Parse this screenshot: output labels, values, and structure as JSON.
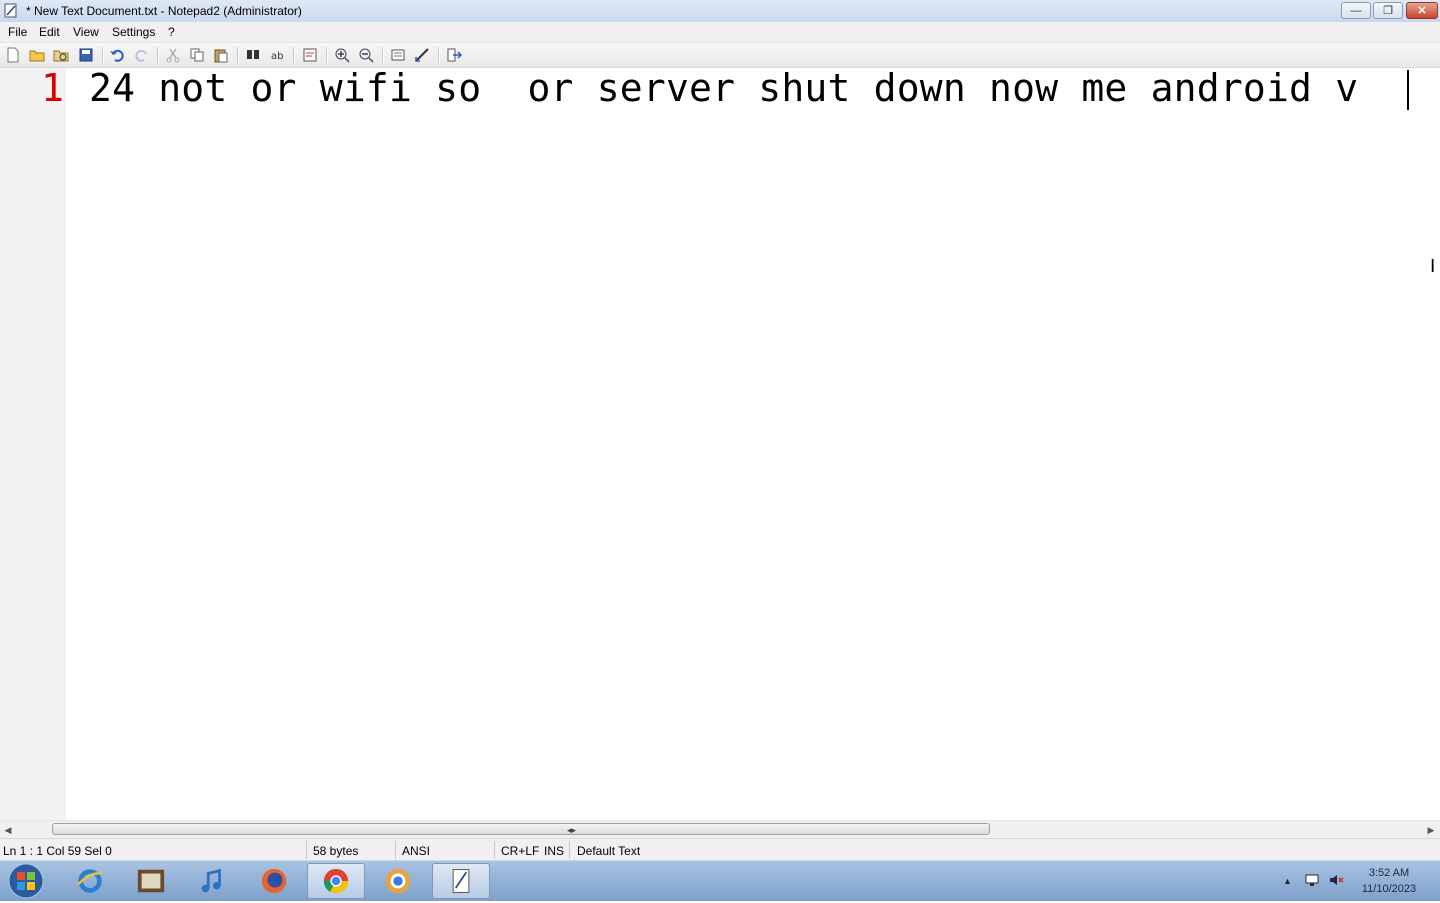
{
  "window": {
    "title": "* New Text Document.txt - Notepad2 (Administrator)",
    "minimize_symbol": "—",
    "maximize_symbol": "❐",
    "close_symbol": "✕"
  },
  "menu": {
    "items": [
      {
        "label": "File"
      },
      {
        "label": "Edit"
      },
      {
        "label": "View"
      },
      {
        "label": "Settings"
      },
      {
        "label": "?"
      }
    ]
  },
  "toolbar": {
    "icons": [
      "new-icon",
      "open-icon",
      "browse-icon",
      "save-icon",
      "undo-icon",
      "redo-icon",
      "cut-icon",
      "copy-icon",
      "paste-icon",
      "find-icon",
      "replace-icon",
      "word-wrap-icon",
      "zoom-in-icon",
      "zoom-out-icon",
      "select-scheme-icon",
      "customize-schemes-icon",
      "exit-icon"
    ]
  },
  "editor": {
    "line_number": "1",
    "line_text": "24 not or wifi so  or server shut down now me android v",
    "line_number_color": "#e00000"
  },
  "statusbar": {
    "position": "Ln 1 : 1   Col 59   Sel 0",
    "size": "58 bytes",
    "encoding": "ANSI",
    "line_ending": "CR+LF",
    "insert_mode": "INS",
    "scheme": "Default Text"
  },
  "taskbar": {
    "apps": [
      "internet-explorer-icon",
      "media-player-icon",
      "itunes-icon",
      "firefox-icon",
      "chrome-icon",
      "chrome-variant-icon",
      "notepad2-icon"
    ],
    "time": "3:52 AM",
    "date": "11/10/2023"
  }
}
